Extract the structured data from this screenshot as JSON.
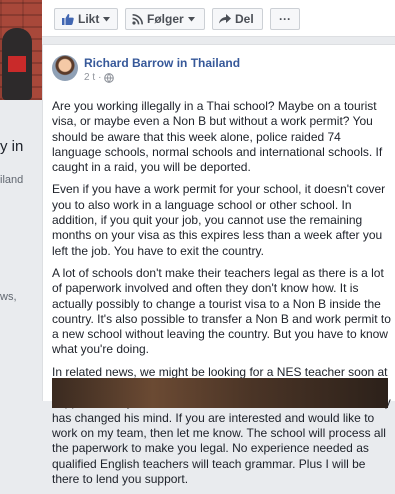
{
  "sidebar": {
    "partial_1": "y in",
    "partial_2": "iland",
    "partial_3": "ws,"
  },
  "actions": {
    "like_label": "Likt",
    "follow_label": "Følger",
    "share_label": "Del",
    "more_label": "···"
  },
  "post": {
    "author": "Richard Barrow in Thailand",
    "time": "2 t",
    "separator": "·",
    "paragraphs": [
      "Are you working illegally in a Thai school? Maybe on a tourist visa, or maybe even a Non B but without a work permit? You should be aware that this week alone, police raided 74 language schools, normal schools and international schools. If caught in a raid, you will be deported.",
      "Even if you have a work permit for your school, it doesn't cover you to also work in a language school or other school. In addition, if you quit your job, you cannot use the remaining months on your visa as this expires less than a week after you left the job. You have to exit the country.",
      "A lot of schools don't make their teachers legal as there is a lot of paperwork involved and often they don't know how. It is actually possibly to change a tourist visa to a Non B inside the country. It's also possible to transfer a Non B and work permit to a new school without leaving the country. But you have to know what you're doing.",
      "In related news, we might be looking for a NES teacher soon at the school where I work. Looks like a teacher who was supposed to fly here in time for the new term to start in mid-May has changed his mind. If you are interested and would like to work on my team, then let me know. The school will process all the paperwork to make you legal. No experience needed as qualified English teachers will teach grammar. Plus I will be there to lend you support."
    ]
  },
  "colors": {
    "link": "#365899",
    "page_bg": "#e9ebee"
  }
}
